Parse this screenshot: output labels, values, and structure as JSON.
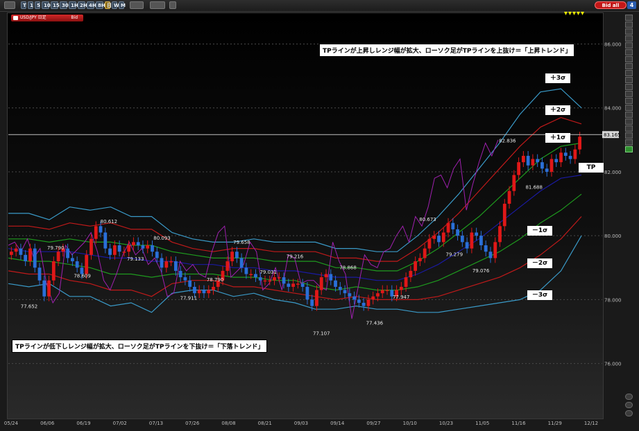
{
  "toolbar": {
    "timeframes": [
      "T",
      "1",
      "5",
      "10",
      "15",
      "30",
      "1H",
      "2H",
      "4H",
      "8H",
      "日",
      "W",
      "M"
    ],
    "active_timeframe": "日",
    "bid_all_label": "Bid all",
    "panel_number": "4"
  },
  "symbol": {
    "name": "USD/JPY 日足",
    "side": "Bid"
  },
  "annotations": {
    "up_trend": "TPラインが上昇しレンジ幅が拡大、ローソク足がTPラインを上抜け＝「上昇トレンド」",
    "down_trend": "TPラインが低下しレンジ幅が拡大、ローソク足がTPラインを下抜け＝「下落トレンド」",
    "sigma_labels": [
      "＋3σ",
      "＋2σ",
      "＋1σ",
      "TP",
      "－1σ",
      "－2σ",
      "－3σ"
    ]
  },
  "right_tools": [
    "tool-1",
    "tool-2",
    "tool-3",
    "tool-4",
    "tool-5",
    "tool-6",
    "tool-7",
    "tool-8",
    "tool-9",
    "tool-10",
    "tool-11",
    "tool-12",
    "tool-13",
    "tool-14",
    "tool-15",
    "tool-16",
    "tool-17",
    "tool-18",
    "tool-19",
    "tool-20"
  ],
  "colors": {
    "up": "#e01818",
    "down": "#2a6fd8",
    "tp": "#1a1aa0",
    "s1": "#1e9a1e",
    "s2": "#c01a1a",
    "s3": "#3a9ac8",
    "other": "#a020b0",
    "marker": "#e8e800"
  },
  "chart_data": {
    "type": "candlestick",
    "title": "USD/JPY 日足",
    "x_tick_labels": [
      "05/24",
      "06/06",
      "06/19",
      "07/02",
      "07/13",
      "07/26",
      "08/08",
      "08/21",
      "09/03",
      "09/14",
      "09/27",
      "10/10",
      "10/23",
      "11/05",
      "11/16",
      "11/29",
      "12/12"
    ],
    "y_tick_labels": [
      "76.000",
      "78.000",
      "80.000",
      "82.000",
      "84.000",
      "86.000"
    ],
    "ylim": [
      74.3,
      86.9
    ],
    "current_price": "83.165",
    "price_labels": [
      {
        "text": "77.652",
        "value": 77.652
      },
      {
        "text": "79.790",
        "value": 79.79
      },
      {
        "text": "78.609",
        "value": 78.609
      },
      {
        "text": "80.612",
        "value": 80.612
      },
      {
        "text": "79.133",
        "value": 79.133
      },
      {
        "text": "80.093",
        "value": 80.093
      },
      {
        "text": "77.911",
        "value": 77.911
      },
      {
        "text": "78.790",
        "value": 78.79
      },
      {
        "text": "79.658",
        "value": 79.658
      },
      {
        "text": "79.031",
        "value": 79.031
      },
      {
        "text": "79.216",
        "value": 79.216
      },
      {
        "text": "77.107",
        "value": 77.107
      },
      {
        "text": "78.868",
        "value": 78.868
      },
      {
        "text": "77.436",
        "value": 77.436
      },
      {
        "text": "77.947",
        "value": 77.947
      },
      {
        "text": "80.673",
        "value": 80.673
      },
      {
        "text": "79.279",
        "value": 79.279
      },
      {
        "text": "79.076",
        "value": 79.076
      },
      {
        "text": "82.836",
        "value": 82.836
      },
      {
        "text": "81.688",
        "value": 81.688
      },
      {
        "text": "82.827",
        "value": 82.827
      }
    ],
    "close": [
      79.5,
      79.6,
      79.4,
      79.2,
      79.6,
      79.0,
      78.6,
      78.1,
      78.6,
      79.2,
      79.5,
      79.6,
      79.3,
      79.2,
      79.0,
      78.8,
      79.4,
      79.9,
      80.3,
      80.1,
      79.6,
      79.4,
      79.7,
      79.5,
      79.5,
      79.7,
      79.8,
      79.7,
      79.6,
      79.7,
      79.5,
      79.3,
      79.0,
      79.2,
      79.2,
      78.9,
      78.7,
      78.6,
      78.4,
      78.2,
      78.3,
      78.2,
      78.3,
      78.4,
      78.6,
      78.9,
      79.2,
      79.5,
      79.3,
      79.0,
      78.8,
      78.8,
      78.7,
      78.6,
      78.6,
      78.6,
      78.7,
      78.7,
      78.5,
      78.4,
      78.5,
      78.5,
      78.4,
      78.0,
      77.8,
      78.3,
      78.7,
      78.8,
      78.6,
      78.4,
      78.3,
      78.2,
      78.1,
      78.0,
      77.9,
      77.8,
      78.0,
      78.1,
      78.2,
      78.3,
      78.3,
      78.1,
      78.3,
      78.4,
      78.7,
      78.9,
      79.2,
      79.3,
      79.6,
      79.9,
      80.0,
      79.8,
      80.1,
      80.4,
      80.2,
      80.0,
      79.8,
      79.6,
      80.1,
      80.0,
      79.7,
      79.5,
      79.3,
      79.8,
      80.3,
      81.0,
      81.4,
      81.9,
      82.3,
      82.5,
      82.2,
      82.4,
      82.3,
      82.1,
      82.0,
      82.4,
      82.3,
      82.6,
      82.5,
      82.4,
      82.7,
      83.1
    ],
    "bands": {
      "tp": [
        79.6,
        79.5,
        79.5,
        79.5,
        79.4,
        79.3,
        79.3,
        79.2,
        79.2,
        79.1,
        79.1,
        79.0,
        79.0,
        78.9,
        78.9,
        78.8,
        78.7,
        78.7,
        78.6,
        78.6,
        78.8,
        79.1,
        79.5,
        79.9,
        80.4,
        80.9,
        81.4,
        81.8,
        81.9
      ],
      "p1": [
        79.9,
        79.9,
        79.8,
        79.9,
        79.8,
        79.8,
        79.7,
        79.7,
        79.5,
        79.4,
        79.3,
        79.3,
        79.3,
        79.2,
        79.2,
        79.2,
        79.0,
        79.0,
        78.9,
        78.9,
        79.2,
        79.6,
        80.1,
        80.6,
        81.2,
        81.8,
        82.4,
        82.8,
        82.9
      ],
      "m1": [
        79.3,
        79.2,
        79.2,
        79.1,
        79.0,
        78.8,
        78.8,
        78.7,
        78.8,
        78.8,
        78.8,
        78.7,
        78.7,
        78.6,
        78.6,
        78.4,
        78.3,
        78.4,
        78.3,
        78.3,
        78.4,
        78.6,
        78.9,
        79.2,
        79.5,
        79.9,
        80.4,
        80.8,
        81.3
      ],
      "p2": [
        80.3,
        80.3,
        80.2,
        80.4,
        80.3,
        80.4,
        80.2,
        80.2,
        79.8,
        79.6,
        79.5,
        79.6,
        79.6,
        79.5,
        79.5,
        79.5,
        79.3,
        79.3,
        79.2,
        79.2,
        79.6,
        80.1,
        80.7,
        81.4,
        82.1,
        82.8,
        83.4,
        83.7,
        83.5
      ],
      "m2": [
        78.9,
        78.8,
        78.8,
        78.6,
        78.5,
        78.3,
        78.3,
        78.1,
        78.5,
        78.6,
        78.6,
        78.4,
        78.4,
        78.3,
        78.2,
        78.1,
        78.0,
        78.1,
        78.0,
        78.0,
        78.0,
        78.1,
        78.3,
        78.5,
        78.7,
        79.0,
        79.4,
        79.9,
        80.6
      ],
      "p3": [
        80.7,
        80.7,
        80.5,
        80.9,
        80.8,
        80.9,
        80.6,
        80.6,
        80.1,
        79.9,
        79.8,
        79.8,
        79.9,
        79.8,
        79.8,
        79.8,
        79.6,
        79.6,
        79.5,
        79.5,
        80.0,
        80.6,
        81.3,
        82.1,
        82.9,
        83.8,
        84.5,
        84.6,
        84.0
      ],
      "m3": [
        78.5,
        78.4,
        78.5,
        78.1,
        78.1,
        77.8,
        77.9,
        77.6,
        78.2,
        78.3,
        78.3,
        78.1,
        78.2,
        78.0,
        77.9,
        77.7,
        77.7,
        77.8,
        77.7,
        77.7,
        77.6,
        77.6,
        77.7,
        77.8,
        77.9,
        78.0,
        78.3,
        78.9,
        80.0
      ]
    },
    "other_line": [
      79.7,
      79.8,
      79.5,
      79.9,
      79.3,
      79.6,
      78.5,
      77.9,
      78.2,
      79.7,
      79.4,
      79.6,
      79.8,
      80.1,
      79.5,
      78.6,
      78.3,
      78.8,
      79.4,
      79.8,
      79.4,
      79.6,
      79.1,
      79.3,
      78.9,
      78.1,
      78.2,
      79.2,
      78.9,
      79.1,
      78.8,
      78.7,
      79.5,
      80.1,
      80.3,
      78.7,
      78.9,
      79.1,
      79.8,
      79.5,
      78.3,
      78.5,
      79.0,
      78.3,
      79.4,
      79.3,
      78.5,
      78.6,
      78.6,
      78.4,
      78.3,
      79.8,
      79.2,
      78.8,
      77.4,
      78.4,
      79.4,
      79.1,
      79.0,
      79.5,
      79.6,
      80.0,
      80.3,
      79.8,
      80.6,
      80.3,
      80.9,
      81.8,
      81.9,
      81.5,
      82.1,
      82.4,
      80.8,
      81.6,
      82.3,
      82.9,
      82.5,
      83.0
    ]
  }
}
